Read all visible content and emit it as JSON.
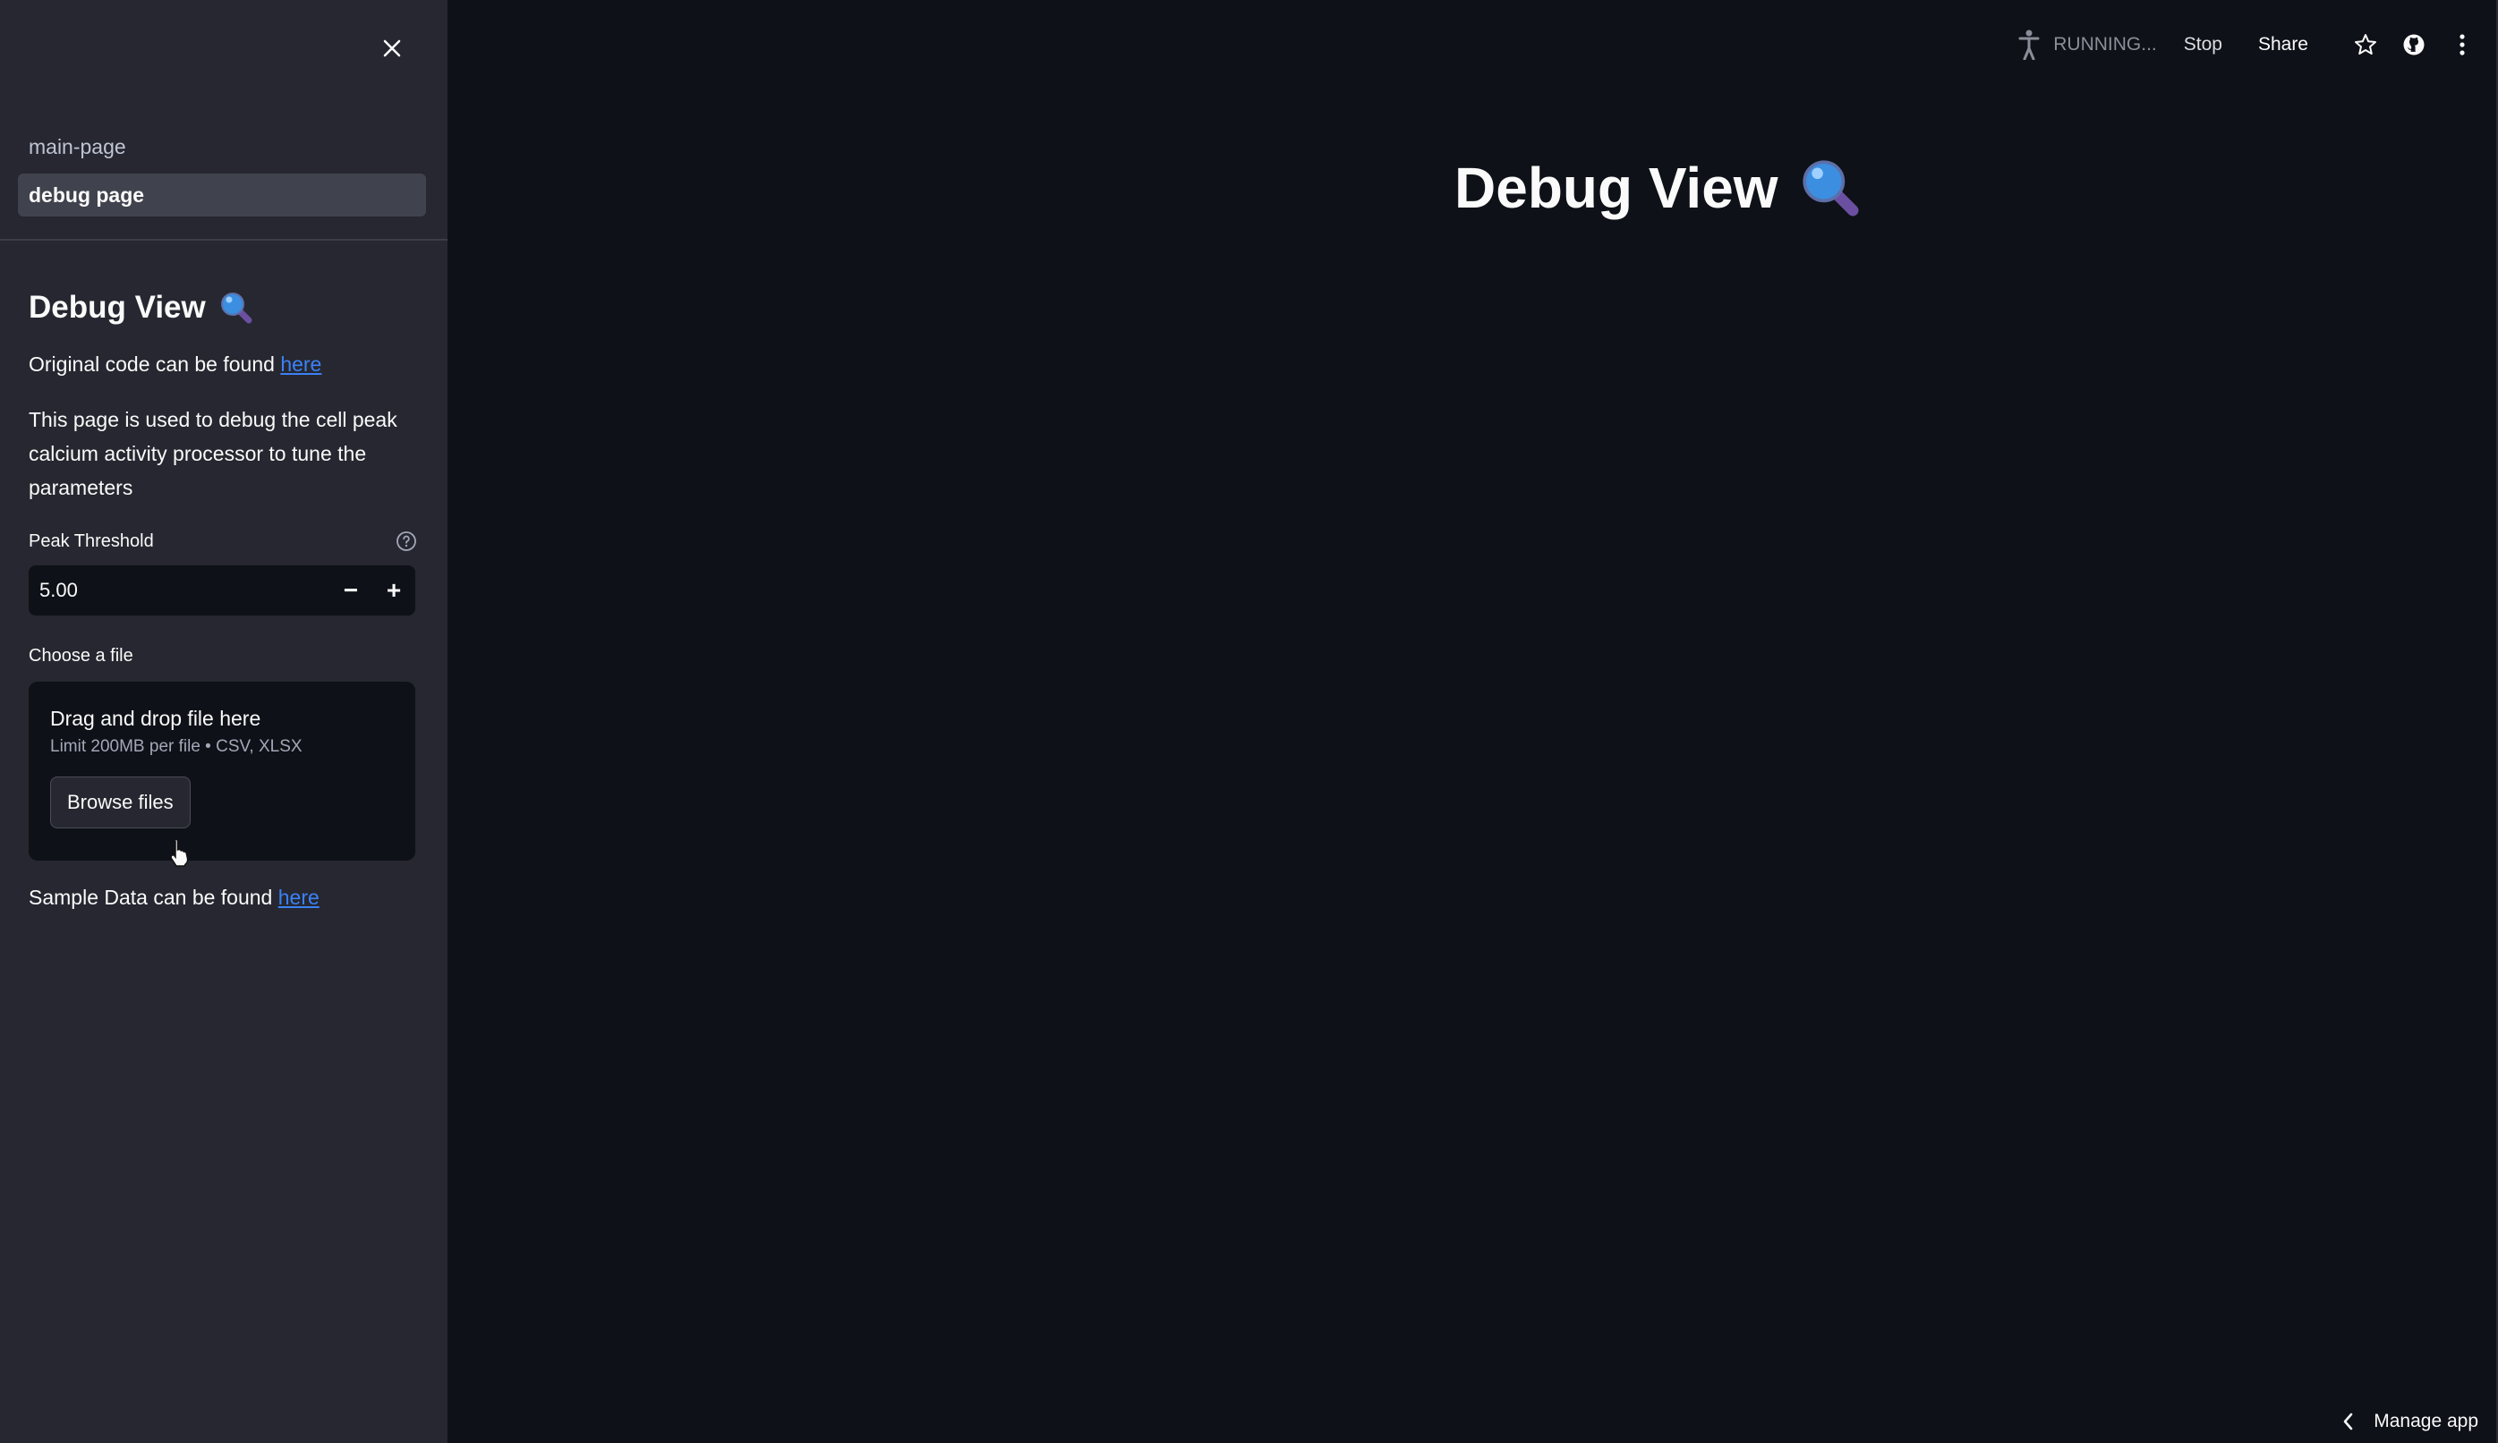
{
  "sidebar": {
    "nav_items": [
      {
        "label": "main-page",
        "active": false
      },
      {
        "label": "debug page",
        "active": true
      }
    ],
    "heading": "Debug View",
    "heading_icon": "magnifying-glass-icon",
    "original_code_text": "Original code can be found ",
    "original_code_link": "here",
    "description": "This page is used to debug the cell peak calcium activity processor to tune the parameters",
    "peak_threshold": {
      "label": "Peak Threshold",
      "value": "5.00",
      "minus": "−",
      "plus": "+"
    },
    "file_uploader": {
      "label": "Choose a file",
      "dropzone_title": "Drag and drop file here",
      "dropzone_limit": "Limit 200MB per file • CSV, XLSX",
      "browse_label": "Browse files"
    },
    "sample_data_text": "Sample Data can be found ",
    "sample_data_link": "here"
  },
  "toolbar": {
    "running_label": "RUNNING...",
    "stop_label": "Stop",
    "share_label": "Share"
  },
  "main": {
    "title": "Debug View"
  },
  "footer": {
    "manage_app_label": "Manage app"
  },
  "colors": {
    "background": "#0e1117",
    "sidebar": "#262730",
    "link": "#3b82f6"
  }
}
